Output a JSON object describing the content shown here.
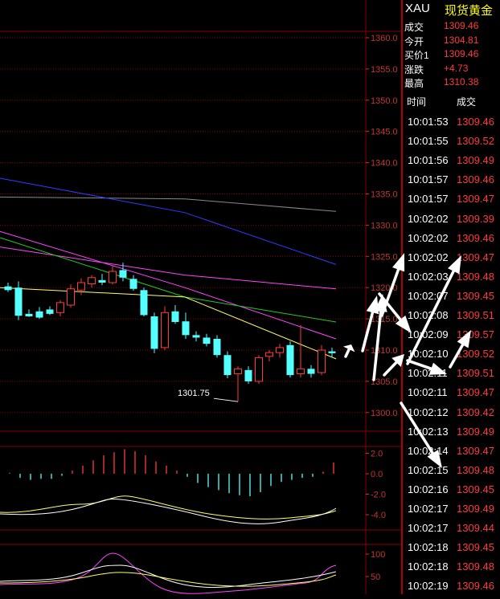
{
  "colors": {
    "background": "#000000",
    "up": "#ff3b3b",
    "down": "#54ffff",
    "grid": "#8b0000",
    "axis_text": "#c0392b",
    "ma_blue": "#2f3bff",
    "ma_gray": "#8a8a8a",
    "ma_magenta": "#ff44ff",
    "ma_green": "#22cc22",
    "ma_yellow": "#ffff66",
    "ma_white": "#ffffff",
    "arrow": "#ffffff"
  },
  "header": {
    "code": "XAU",
    "name": "现货黄金"
  },
  "quote": [
    {
      "label": "成交",
      "value": "1309.46"
    },
    {
      "label": "今开",
      "value": "1304.81"
    },
    {
      "label": "买价1",
      "value": "1309.46"
    },
    {
      "label": "涨跌",
      "value": "+4.73"
    },
    {
      "label": "最高",
      "value": "1310.38"
    }
  ],
  "ticks_header": {
    "time": "时间",
    "price": "成交"
  },
  "ticks": [
    {
      "time": "10:01:53",
      "price": "1309.46"
    },
    {
      "time": "10:01:55",
      "price": "1309.52"
    },
    {
      "time": "10:01:56",
      "price": "1309.49"
    },
    {
      "time": "10:01:57",
      "price": "1309.46"
    },
    {
      "time": "10:01:57",
      "price": "1309.47"
    },
    {
      "time": "10:02:02",
      "price": "1309.39"
    },
    {
      "time": "10:02:02",
      "price": "1309.46"
    },
    {
      "time": "10:02:02",
      "price": "1309.47"
    },
    {
      "time": "10:02:03",
      "price": "1309.48"
    },
    {
      "time": "10:02:07",
      "price": "1309.45"
    },
    {
      "time": "10:02:08",
      "price": "1309.51"
    },
    {
      "time": "10:02:09",
      "price": "1309.57"
    },
    {
      "time": "10:02:10",
      "price": "1309.52"
    },
    {
      "time": "10:02:11",
      "price": "1309.51"
    },
    {
      "time": "10:02:11",
      "price": "1309.47"
    },
    {
      "time": "10:02:12",
      "price": "1309.42"
    },
    {
      "time": "10:02:13",
      "price": "1309.49"
    },
    {
      "time": "10:02:14",
      "price": "1309.47"
    },
    {
      "time": "10:02:15",
      "price": "1309.48"
    },
    {
      "time": "10:02:16",
      "price": "1309.45"
    },
    {
      "time": "10:02:17",
      "price": "1309.49"
    },
    {
      "time": "10:02:17",
      "price": "1309.44"
    },
    {
      "time": "10:02:18",
      "price": "1309.45"
    },
    {
      "time": "10:02:18",
      "price": "1309.48"
    },
    {
      "time": "10:02:19",
      "price": "1309.46"
    }
  ],
  "chart_data": [
    {
      "type": "candlestick",
      "y_ticks": [
        "1360.0",
        "1355.0",
        "1350.0",
        "1345.0",
        "1340.0",
        "1335.0",
        "1330.0",
        "1325.0",
        "1320.0",
        "1315.0",
        "1310.0",
        "1305.0",
        "1300.0"
      ],
      "ylim": [
        1297,
        1361
      ],
      "low_label": "1301.75",
      "candles": [
        {
          "o": 1320.2,
          "h": 1320.8,
          "l": 1319.3,
          "c": 1319.6
        },
        {
          "o": 1320.0,
          "h": 1321.0,
          "l": 1314.8,
          "c": 1315.5
        },
        {
          "o": 1315.8,
          "h": 1316.5,
          "l": 1315.3,
          "c": 1315.4
        },
        {
          "o": 1316.2,
          "h": 1316.9,
          "l": 1315.0,
          "c": 1315.2
        },
        {
          "o": 1316.5,
          "h": 1317.0,
          "l": 1315.6,
          "c": 1315.8
        },
        {
          "o": 1316.0,
          "h": 1318.0,
          "l": 1315.4,
          "c": 1317.6
        },
        {
          "o": 1317.2,
          "h": 1320.5,
          "l": 1316.8,
          "c": 1319.8
        },
        {
          "o": 1319.6,
          "h": 1321.5,
          "l": 1318.8,
          "c": 1320.8
        },
        {
          "o": 1320.6,
          "h": 1322.0,
          "l": 1320.0,
          "c": 1321.6
        },
        {
          "o": 1321.2,
          "h": 1322.2,
          "l": 1320.4,
          "c": 1320.8
        },
        {
          "o": 1320.8,
          "h": 1323.5,
          "l": 1320.5,
          "c": 1322.6
        },
        {
          "o": 1322.8,
          "h": 1324.0,
          "l": 1321.0,
          "c": 1321.6
        },
        {
          "o": 1321.4,
          "h": 1322.0,
          "l": 1319.5,
          "c": 1319.8
        },
        {
          "o": 1319.6,
          "h": 1320.0,
          "l": 1315.4,
          "c": 1315.6
        },
        {
          "o": 1315.4,
          "h": 1316.0,
          "l": 1309.5,
          "c": 1310.2
        },
        {
          "o": 1310.4,
          "h": 1317.0,
          "l": 1310.0,
          "c": 1316.0
        },
        {
          "o": 1316.2,
          "h": 1317.2,
          "l": 1314.2,
          "c": 1314.5
        },
        {
          "o": 1314.6,
          "h": 1316.0,
          "l": 1311.8,
          "c": 1312.4
        },
        {
          "o": 1312.4,
          "h": 1313.0,
          "l": 1311.4,
          "c": 1312.0
        },
        {
          "o": 1312.0,
          "h": 1312.6,
          "l": 1310.6,
          "c": 1311.0
        },
        {
          "o": 1311.8,
          "h": 1312.4,
          "l": 1308.8,
          "c": 1309.2
        },
        {
          "o": 1309.2,
          "h": 1309.8,
          "l": 1305.5,
          "c": 1306.0
        },
        {
          "o": 1306.2,
          "h": 1307.4,
          "l": 1301.75,
          "c": 1307.0
        },
        {
          "o": 1306.8,
          "h": 1307.4,
          "l": 1304.6,
          "c": 1305.0
        },
        {
          "o": 1305.0,
          "h": 1309.2,
          "l": 1304.6,
          "c": 1308.8
        },
        {
          "o": 1309.0,
          "h": 1310.0,
          "l": 1308.2,
          "c": 1309.6
        },
        {
          "o": 1309.6,
          "h": 1311.0,
          "l": 1308.8,
          "c": 1310.4
        },
        {
          "o": 1310.8,
          "h": 1311.4,
          "l": 1305.6,
          "c": 1306.0
        },
        {
          "o": 1306.2,
          "h": 1314.0,
          "l": 1305.6,
          "c": 1307.0
        },
        {
          "o": 1307.0,
          "h": 1307.6,
          "l": 1305.6,
          "c": 1306.2
        },
        {
          "o": 1306.4,
          "h": 1310.8,
          "l": 1306.0,
          "c": 1310.0
        },
        {
          "o": 1309.8,
          "h": 1310.4,
          "l": 1308.8,
          "c": 1309.5
        }
      ],
      "ma_lines": [
        {
          "color": "ma_gray",
          "values": [
            1334.5,
            1334.2,
            1332.2
          ]
        },
        {
          "color": "ma_blue",
          "values": [
            1337.5,
            1332.0,
            1323.7
          ]
        },
        {
          "color": "ma_magenta",
          "values": [
            1326.5,
            1322.0,
            1319.8
          ]
        },
        {
          "color": "ma_magenta",
          "values": [
            1329.0,
            1320.0,
            1311.8
          ]
        },
        {
          "color": "ma_green",
          "values": [
            1328.0,
            1318.5,
            1314.5
          ]
        },
        {
          "color": "ma_yellow",
          "values": [
            1320.0,
            1318.5,
            1308.6
          ]
        }
      ]
    },
    {
      "type": "bar",
      "y_ticks": [
        "2.0",
        "0.0",
        "-2.0",
        "-4.0"
      ],
      "ylim": [
        -5.2,
        3.0
      ],
      "values": [
        0.1,
        -0.4,
        -0.6,
        -0.5,
        -0.5,
        -0.2,
        0.3,
        0.8,
        1.3,
        1.8,
        2.1,
        2.4,
        2.2,
        1.8,
        1.2,
        0.8,
        0.3,
        -0.3,
        -0.9,
        -1.3,
        -1.6,
        -1.9,
        -2.1,
        -2.2,
        -1.8,
        -1.2,
        -0.8,
        -0.6,
        -0.4,
        -0.3,
        0.2,
        1.1
      ]
    },
    {
      "type": "line",
      "y_ticks": [
        "100",
        "50"
      ],
      "ylim": [
        25,
        110
      ]
    }
  ],
  "annotations": {
    "arrows": [
      [
        [
          430,
          444
        ],
        [
          437,
          429
        ]
      ],
      [
        [
          451,
          437
        ],
        [
          469,
          368
        ]
      ],
      [
        [
          475,
          393
        ],
        [
          503,
          315
        ]
      ],
      [
        [
          465,
          473
        ],
        [
          476,
          366
        ]
      ],
      [
        [
          472,
          366
        ],
        [
          512,
          415
        ]
      ],
      [
        [
          478,
          467
        ],
        [
          503,
          441
        ]
      ],
      [
        [
          507,
          449
        ],
        [
          556,
          466
        ]
      ],
      [
        [
          507,
          453
        ],
        [
          574,
          318
        ]
      ],
      [
        [
          560,
          457
        ],
        [
          586,
          411
        ]
      ],
      [
        [
          499,
          502
        ],
        [
          550,
          583
        ]
      ]
    ]
  }
}
